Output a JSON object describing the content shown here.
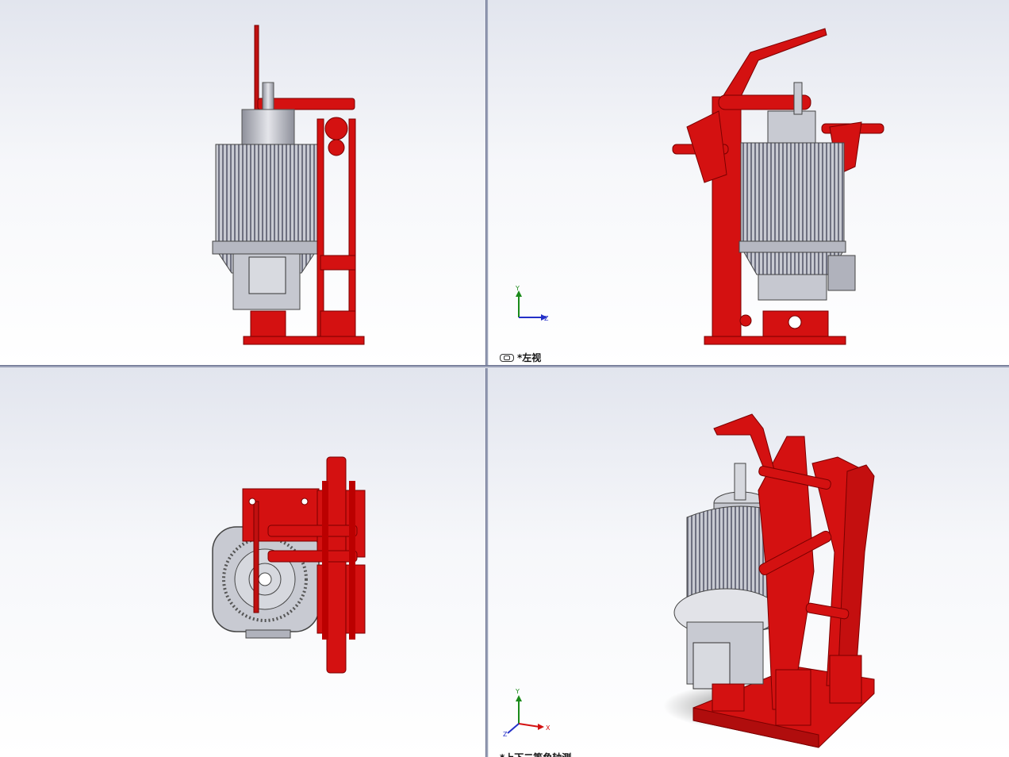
{
  "viewports": {
    "front": {
      "label": ""
    },
    "left": {
      "label": "*左视"
    },
    "top": {
      "label": ""
    },
    "iso": {
      "label": "*上下二等角轴测"
    }
  },
  "triad": {
    "x": "X",
    "y": "Y",
    "z": "Z"
  },
  "colors": {
    "frame": "#d41111",
    "motor": "#b8bac4",
    "background": "#eef0f5"
  }
}
